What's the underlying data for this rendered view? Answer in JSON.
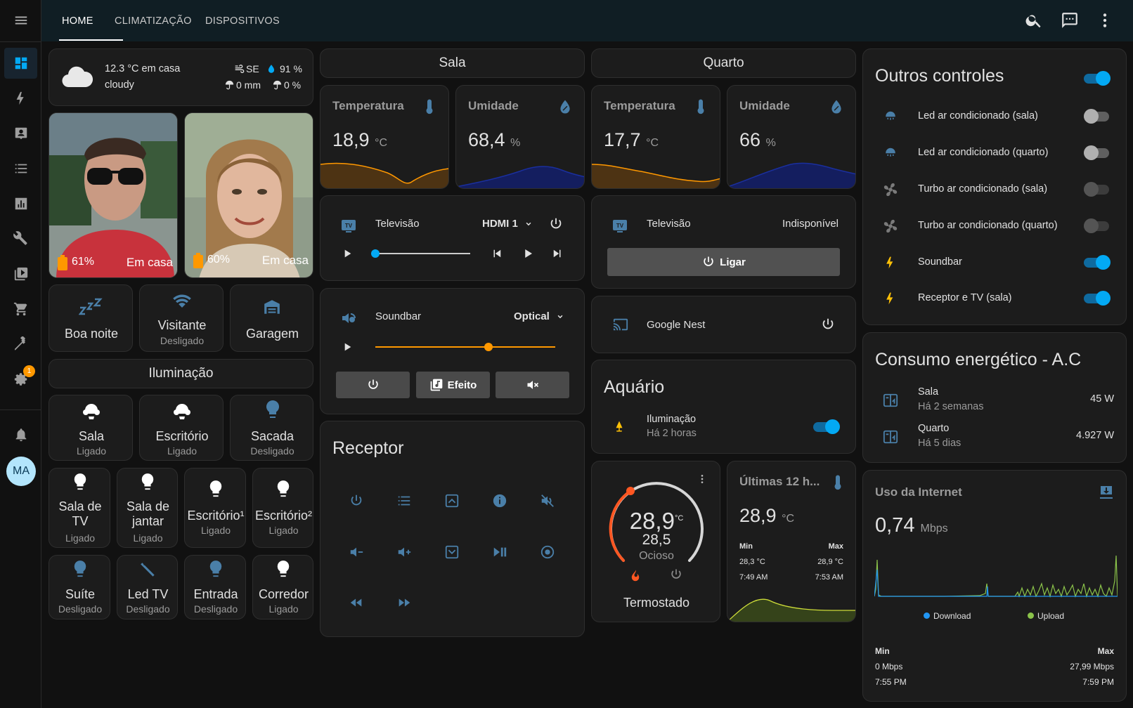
{
  "tabs": [
    "HOME",
    "CLIMATIZAÇÃO",
    "DISPOSITIVOS"
  ],
  "sidebar": {
    "badge": "1",
    "avatar": "MA"
  },
  "weather": {
    "line1": "12.3 °C em casa",
    "condition": "cloudy",
    "wind": "SE",
    "humidity": "91 %",
    "precip": "0 mm",
    "precip_prob": "0 %"
  },
  "people": [
    {
      "battery": "61%",
      "state": "Em casa"
    },
    {
      "battery": "60%",
      "state": "Em casa"
    }
  ],
  "scenes": [
    {
      "name": "Boa noite",
      "state": ""
    },
    {
      "name": "Visitante",
      "state": "Desligado"
    },
    {
      "name": "Garagem",
      "state": ""
    }
  ],
  "lighting": {
    "title": "Iluminação",
    "row1": [
      {
        "name": "Sala",
        "state": "Ligado"
      },
      {
        "name": "Escritório",
        "state": "Ligado"
      },
      {
        "name": "Sacada",
        "state": "Desligado"
      }
    ],
    "row2": [
      {
        "name": "Sala de TV",
        "state": "Ligado"
      },
      {
        "name": "Sala de jantar",
        "state": "Ligado"
      },
      {
        "name": "Escritório¹",
        "state": "Ligado"
      },
      {
        "name": "Escritório²",
        "state": "Ligado"
      }
    ],
    "row3": [
      {
        "name": "Suíte",
        "state": "Desligado"
      },
      {
        "name": "Led TV",
        "state": "Desligado"
      },
      {
        "name": "Entrada",
        "state": "Desligado"
      },
      {
        "name": "Corredor",
        "state": "Ligado"
      }
    ]
  },
  "sala": {
    "title": "Sala",
    "temp_label": "Temperatura",
    "temp": "18,9",
    "temp_unit": "°C",
    "hum_label": "Umidade",
    "hum": "68,4",
    "hum_unit": "%",
    "tv": {
      "name": "Televisão",
      "source": "HDMI 1",
      "progress": 0
    },
    "soundbar": {
      "name": "Soundbar",
      "source": "Optical",
      "volume": 0.63,
      "effect_label": "Efeito"
    }
  },
  "quarto": {
    "title": "Quarto",
    "temp_label": "Temperatura",
    "temp": "17,7",
    "temp_unit": "°C",
    "hum_label": "Umidade",
    "hum": "66",
    "hum_unit": "%",
    "tv": {
      "name": "Televisão",
      "status": "Indisponível",
      "on_label": "Ligar"
    },
    "nest": {
      "name": "Google Nest"
    }
  },
  "receptor": {
    "title": "Receptor"
  },
  "aquario": {
    "title": "Aquário",
    "name": "Iluminação",
    "time": "Há 2 horas",
    "on": true
  },
  "thermostat": {
    "current": "28,9",
    "unit": "°C",
    "target": "28,5",
    "state": "Ocioso",
    "name": "Termostado"
  },
  "last12": {
    "title": "Últimas 12 h...",
    "value": "28,9",
    "unit": "°C",
    "min_label": "Min",
    "max_label": "Max",
    "min": "28,3 °C",
    "max": "28,9 °C",
    "min_time": "7:49 AM",
    "max_time": "7:53 AM"
  },
  "outros": {
    "title": "Outros controles",
    "master_on": true,
    "items": [
      {
        "name": "Led ar condicionado (sala)",
        "state": "off"
      },
      {
        "name": "Led ar condicionado (quarto)",
        "state": "off"
      },
      {
        "name": "Turbo ar condicionado (sala)",
        "state": "disabled"
      },
      {
        "name": "Turbo ar condicionado (quarto)",
        "state": "disabled"
      },
      {
        "name": "Soundbar",
        "state": "on"
      },
      {
        "name": "Receptor e TV (sala)",
        "state": "on"
      }
    ]
  },
  "energy": {
    "title": "Consumo energético - A.C",
    "items": [
      {
        "name": "Sala",
        "time": "Há 2 semanas",
        "value": "45 W"
      },
      {
        "name": "Quarto",
        "time": "Há 5 dias",
        "value": "4.927 W"
      }
    ]
  },
  "internet": {
    "title": "Uso da Internet",
    "value": "0,74",
    "unit": "Mbps",
    "legend_download": "Download",
    "legend_upload": "Upload",
    "min_label": "Min",
    "max_label": "Max",
    "min": "0 Mbps",
    "max": "27,99 Mbps",
    "min_time": "7:55 PM",
    "max_time": "7:59 PM"
  },
  "colors": {
    "accent": "#03a9f4",
    "temp_line": "#ff9800",
    "hum_line": "#1a2f9e",
    "battery": "#ff9800",
    "heat": "#ff5722",
    "download": "#2196f3",
    "upload": "#8bc34a"
  }
}
